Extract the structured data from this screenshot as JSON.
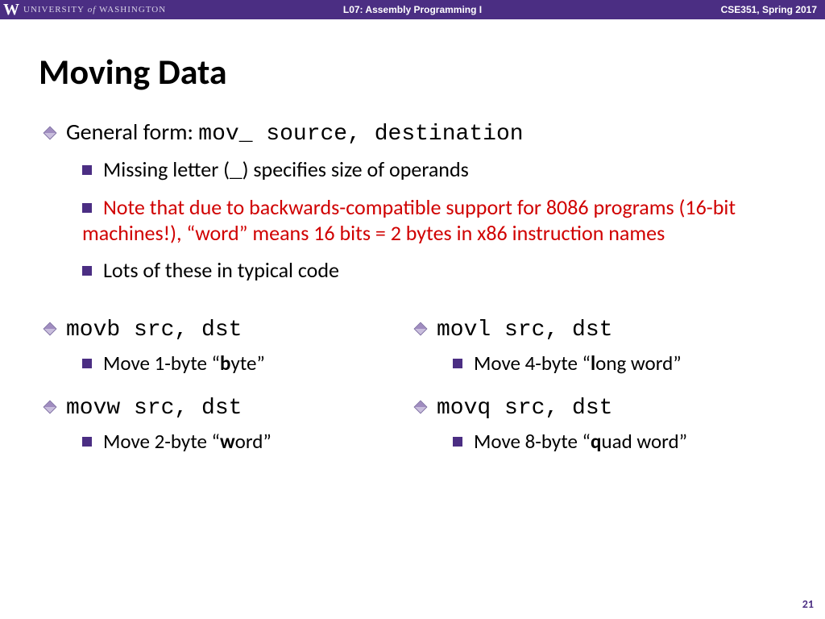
{
  "header": {
    "university_pre": "UNIVERSITY",
    "university_of": " of ",
    "university_post": "WASHINGTON",
    "center": "L07: Assembly Programming I",
    "right": "CSE351, Spring 2017"
  },
  "title": "Moving Data",
  "top": {
    "general_label": "General form:  ",
    "general_code": "mov_ source, destination",
    "sub1_a": "Missing letter (",
    "sub1_b": "_",
    "sub1_c": ") specifies size of operands",
    "sub2": "Note that due to backwards-compatible support for 8086 programs (16-bit machines!), “word” means 16 bits = 2 bytes in x86 instruction names",
    "sub3": "Lots of these in typical code"
  },
  "left": {
    "movb_code": "movb src, dst",
    "movb_desc_a": "Move 1-byte “",
    "movb_desc_b": "b",
    "movb_desc_c": "yte”",
    "movw_code": "movw src, dst",
    "movw_desc_a": "Move 2-byte “",
    "movw_desc_b": "w",
    "movw_desc_c": "ord”"
  },
  "right": {
    "movl_code": "movl src, dst",
    "movl_desc_a": "Move 4-byte “",
    "movl_desc_b": "l",
    "movl_desc_c": "ong word”",
    "movq_code": "movq src, dst",
    "movq_desc_a": "Move 8-byte “",
    "movq_desc_b": "q",
    "movq_desc_c": "uad word”"
  },
  "pagenum": "21"
}
